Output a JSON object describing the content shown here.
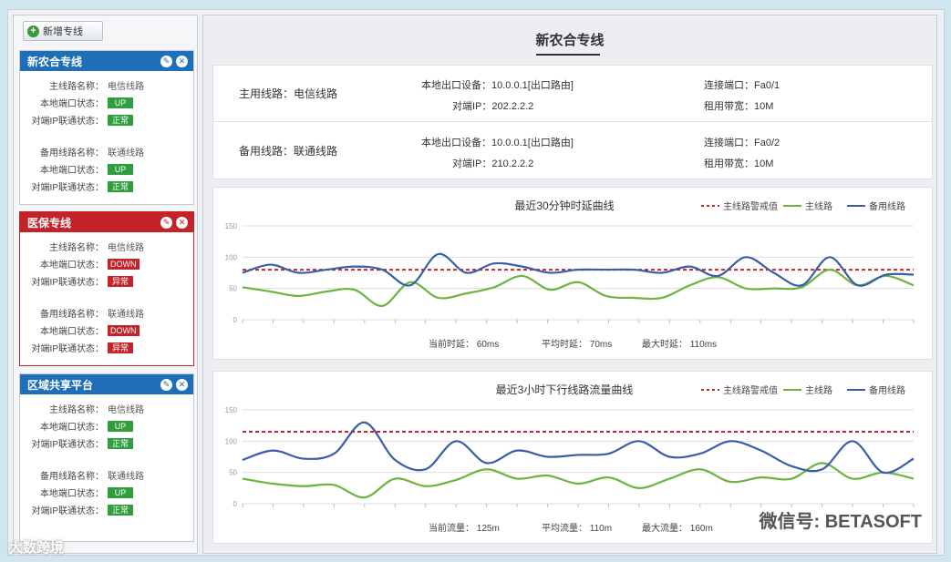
{
  "sidebar": {
    "add_label": "新增专线",
    "cards": [
      {
        "title": "新农合专线",
        "color": "#1e6fb8",
        "primary": [
          {
            "label": "主线路名称：",
            "value": "电信线路",
            "badge": ""
          },
          {
            "label": "本地端口状态：",
            "value": "",
            "badge": "UP"
          },
          {
            "label": "对端IP联通状态：",
            "value": "",
            "badge": "正常"
          }
        ],
        "backup": [
          {
            "label": "备用线路名称：",
            "value": "联通线路",
            "badge": ""
          },
          {
            "label": "本地端口状态：",
            "value": "",
            "badge": "UP"
          },
          {
            "label": "对端IP联通状态：",
            "value": "",
            "badge": "正常"
          }
        ]
      },
      {
        "title": "医保专线",
        "color": "#c4232a",
        "primary": [
          {
            "label": "主线路名称：",
            "value": "电信线路",
            "badge": ""
          },
          {
            "label": "本地端口状态：",
            "value": "",
            "badge": "DOWN"
          },
          {
            "label": "对端IP联通状态：",
            "value": "",
            "badge": "异常"
          }
        ],
        "backup": [
          {
            "label": "备用线路名称：",
            "value": "联通线路",
            "badge": ""
          },
          {
            "label": "本地端口状态：",
            "value": "",
            "badge": "DOWN"
          },
          {
            "label": "对端IP联通状态：",
            "value": "",
            "badge": "异常"
          }
        ]
      },
      {
        "title": "区域共享平台",
        "color": "#1e6fb8",
        "primary": [
          {
            "label": "主线路名称：",
            "value": "电信线路",
            "badge": ""
          },
          {
            "label": "本地端口状态：",
            "value": "",
            "badge": "UP"
          },
          {
            "label": "对端IP联通状态：",
            "value": "",
            "badge": "正常"
          }
        ],
        "backup": [
          {
            "label": "备用线路名称：",
            "value": "联通线路",
            "badge": ""
          },
          {
            "label": "本地端口状态：",
            "value": "",
            "badge": "UP"
          },
          {
            "label": "对端IP联通状态：",
            "value": "",
            "badge": "正常"
          }
        ]
      }
    ]
  },
  "main": {
    "title": "新农合专线",
    "lines": [
      {
        "name": "主用线路：电信线路",
        "device_label": "本地出口设备：",
        "device_value": "10.0.0.1[出口路由]",
        "peer_label": "对端IP：",
        "peer_value": "202.2.2.2",
        "port_label": "连接端口：",
        "port_value": "Fa0/1",
        "bw_label": "租用带宽：",
        "bw_value": "10M"
      },
      {
        "name": "备用线路：联通线路",
        "device_label": "本地出口设备：",
        "device_value": "10.0.0.1[出口路由]",
        "peer_label": "对端IP：",
        "peer_value": "210.2.2.2",
        "port_label": "连接端口：",
        "port_value": "Fa0/2",
        "bw_label": "租用带宽：",
        "bw_value": "10M"
      }
    ]
  },
  "chart_data": [
    {
      "type": "line",
      "title": "最近30分钟时延曲线",
      "ylim": [
        0,
        150
      ],
      "yticks": [
        "0",
        "50",
        "100",
        "150"
      ],
      "legend": [
        "主线路警戒值",
        "主线路",
        "备用线路"
      ],
      "series_colors": [
        "#c4232a",
        "#6db33f",
        "#3a5da8"
      ],
      "threshold": 80,
      "series": [
        {
          "name": "主线路",
          "values": [
            52,
            45,
            38,
            45,
            48,
            22,
            60,
            35,
            42,
            52,
            70,
            48,
            60,
            38,
            35,
            35,
            55,
            68,
            50,
            50,
            52,
            80,
            55,
            70,
            55
          ]
        },
        {
          "name": "备用线路",
          "values": [
            75,
            88,
            75,
            80,
            85,
            80,
            55,
            105,
            75,
            90,
            85,
            75,
            80,
            80,
            80,
            75,
            85,
            70,
            100,
            75,
            55,
            100,
            55,
            72,
            72
          ]
        }
      ],
      "stats": [
        {
          "label": "当前时延：",
          "value": "60ms"
        },
        {
          "label": "平均时延：",
          "value": "70ms"
        },
        {
          "label": "最大时延：",
          "value": "110ms"
        }
      ]
    },
    {
      "type": "line",
      "title": "最近3小时下行线路流量曲线",
      "ylim": [
        0,
        150
      ],
      "yticks": [
        "0",
        "50",
        "100",
        "150"
      ],
      "legend": [
        "主线路警戒值",
        "主线路",
        "备用线路"
      ],
      "series_colors": [
        "#c4232a",
        "#6db33f",
        "#3a5da8"
      ],
      "threshold": 115,
      "series": [
        {
          "name": "主线路",
          "values": [
            40,
            32,
            28,
            30,
            10,
            40,
            28,
            38,
            55,
            40,
            45,
            32,
            42,
            25,
            40,
            55,
            35,
            42,
            40,
            65,
            40,
            50,
            40
          ]
        },
        {
          "name": "备用线路",
          "values": [
            70,
            85,
            72,
            80,
            130,
            70,
            55,
            100,
            65,
            85,
            75,
            78,
            80,
            100,
            75,
            80,
            100,
            85,
            60,
            55,
            100,
            50,
            72
          ]
        }
      ],
      "stats": [
        {
          "label": "当前流量：",
          "value": "125m"
        },
        {
          "label": "平均流量：",
          "value": "110m"
        },
        {
          "label": "最大流量：",
          "value": "160m"
        }
      ]
    }
  ],
  "watermark": "微信号: BETASOFT",
  "watermark2": "大数跨境"
}
